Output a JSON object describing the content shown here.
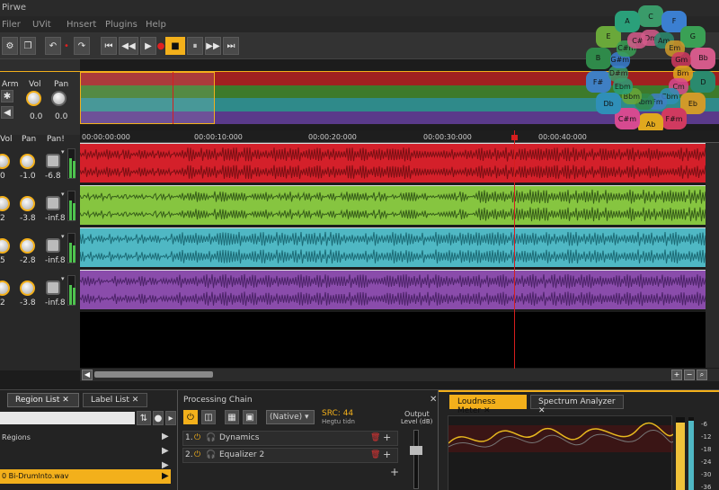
{
  "window": {
    "title": "Pirwe"
  },
  "menu": {
    "file": "Filer",
    "view": "UVit",
    "insert": "Hnsert",
    "plugins": "Plugins",
    "help": "Help"
  },
  "toolbar": {
    "undo": "↶",
    "redo": "↷",
    "go_start": "⏮",
    "rewind": "◀◀",
    "play": "▶",
    "record": "●",
    "stop": "■",
    "pause": "⏸",
    "forward": "▶▶",
    "go_end": "⏭",
    "dot": "•"
  },
  "mixer_header": {
    "arm": "Arm",
    "vol": "Vol",
    "pan": "Pan",
    "vol_value": "0.0",
    "pan_value": "0.0"
  },
  "tracks_header": {
    "vol": "Vol",
    "pan": "Pan",
    "peak": "Pan!"
  },
  "tracks": [
    {
      "vol": "0",
      "pan": "-1.0",
      "peak": "-6.8",
      "color": "#d4202a",
      "wave": "#7a0f14"
    },
    {
      "vol": "2",
      "pan": "-3.8",
      "peak": "-inf.8",
      "color": "#86c540",
      "wave": "#365d19"
    },
    {
      "vol": "5",
      "pan": "-2.8",
      "peak": "-inf.8",
      "color": "#4fb8c4",
      "wave": "#1c6b76"
    },
    {
      "vol": "2",
      "pan": "-3.8",
      "peak": "-inf.8",
      "color": "#8a4cab",
      "wave": "#4c2368"
    }
  ],
  "overview_colors": [
    "#a02020",
    "#3d7a2a",
    "#2f8a8a",
    "#5a3a8a"
  ],
  "ruler": {
    "t0": "00:00:00:000",
    "t1": "00:00:10:000",
    "t2": "00:00:20:000",
    "t3": "00:00:30:000",
    "t4": "00:00:40:000"
  },
  "regions_panel": {
    "tab_region": "Region List",
    "tab_label": "Label List",
    "regions_label": "Rėgions",
    "selected_file": "0 Bi-Drumlnto.wav"
  },
  "processing": {
    "title": "Processing Chain",
    "mode": "(Native)",
    "src_label": "SRC: 44",
    "src_sub": "Hegtu tidn",
    "output_label": "Output",
    "level_label": "Level (dB)",
    "plugins": [
      {
        "index": "1.",
        "name": "Dynamics"
      },
      {
        "index": "2.",
        "name": "Equalizer 2"
      }
    ]
  },
  "loudness": {
    "tab_meter": "Loudness Meter",
    "tab_spectrum": "Spectrum Analyzer",
    "scale": [
      "-6",
      "-12",
      "-18",
      "-24",
      "-30",
      "-36"
    ]
  },
  "circle_of_fifths": {
    "outer": [
      "C",
      "F",
      "G",
      "Bb",
      "D",
      "Eb",
      "F#m",
      "Ab",
      "C#m",
      "Db",
      "F#",
      "B",
      "E",
      "A"
    ],
    "inner": [
      "Dm",
      "Am",
      "Em",
      "Gm",
      "Bm",
      "Cm",
      "Cbm",
      "Fm",
      "Abm",
      "Bbm",
      "Ebm",
      "D#m",
      "G#m",
      "C#m",
      "C#"
    ]
  },
  "colors": {
    "accent": "#f3b01b",
    "playhead": "#d61e1e"
  }
}
